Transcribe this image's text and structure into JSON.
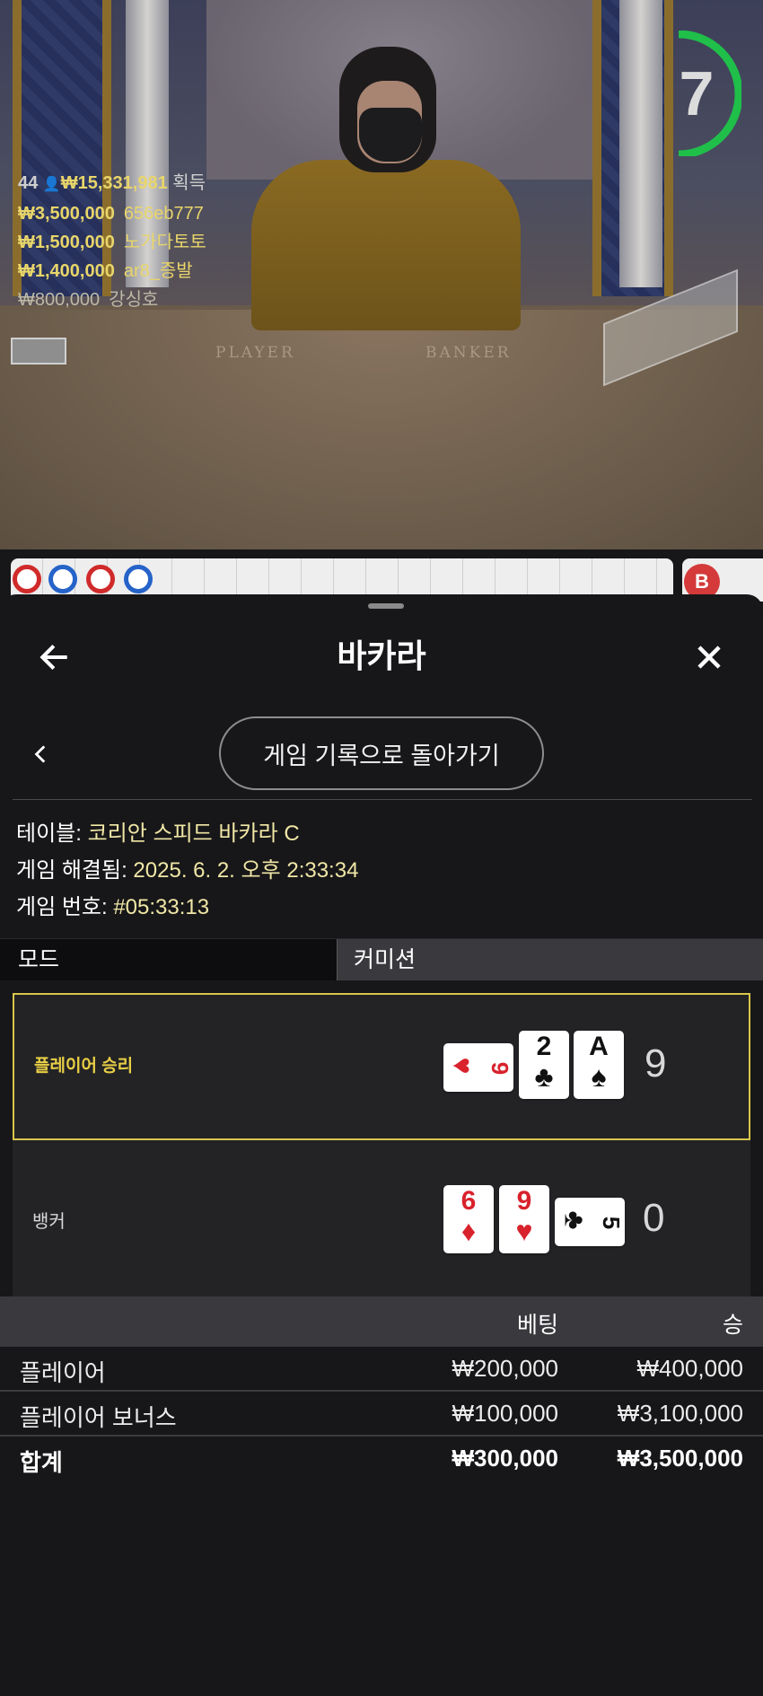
{
  "video": {
    "timer": "7",
    "felt_labels": {
      "player": "PLAYER",
      "banker": "BANKER"
    },
    "winners": {
      "count": "44",
      "total": "₩15,331,981",
      "suffix": "획득",
      "rows": [
        {
          "amount": "₩3,500,000",
          "name": "656eb777"
        },
        {
          "amount": "₩1,500,000",
          "name": "노가다토토"
        },
        {
          "amount": "₩1,400,000",
          "name": "ar8_증발"
        },
        {
          "amount": "₩800,000",
          "name": "강싱호"
        }
      ]
    }
  },
  "roadmap": {
    "badge": "B",
    "beads": [
      "red",
      "blue",
      "red",
      "blue"
    ]
  },
  "sheet": {
    "title": "바카라",
    "back_to_history": "게임 기록으로 돌아가기",
    "info": {
      "table_label": "테이블:",
      "table_value": "코리안 스피드 바카라 C",
      "resolved_label": "게임 해결됨:",
      "resolved_value": "2025. 6. 2. 오후 2:33:34",
      "number_label": "게임 번호:",
      "number_value": "#05:33:13"
    },
    "mode_tabs": {
      "mode": "모드",
      "commission": "커미션"
    },
    "results": {
      "player": {
        "label": "플레이어 승리",
        "score": "9",
        "cards": [
          {
            "rank": "9",
            "suit": "♥",
            "color": "red"
          },
          {
            "rank": "2",
            "suit": "♣",
            "color": "black"
          },
          {
            "rank": "A",
            "suit": "♠",
            "color": "black"
          }
        ]
      },
      "banker": {
        "label": "뱅커",
        "score": "0",
        "cards": [
          {
            "rank": "6",
            "suit": "♦",
            "color": "red"
          },
          {
            "rank": "9",
            "suit": "♥",
            "color": "red"
          },
          {
            "rank": "5",
            "suit": "♣",
            "color": "black"
          }
        ]
      }
    },
    "bets": {
      "headers": {
        "bet": "베팅",
        "win": "승"
      },
      "rows": [
        {
          "name": "플레이어",
          "bet": "₩200,000",
          "win": "₩400,000"
        },
        {
          "name": "플레이어 보너스",
          "bet": "₩100,000",
          "win": "₩3,100,000"
        }
      ],
      "total": {
        "name": "합계",
        "bet": "₩300,000",
        "win": "₩3,500,000"
      }
    }
  }
}
